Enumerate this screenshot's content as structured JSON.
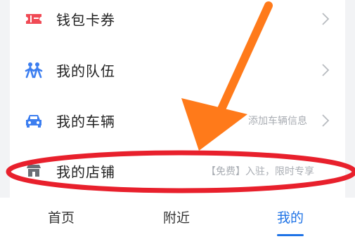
{
  "menu": {
    "items": [
      {
        "label": "钱包卡券",
        "icon": "ticket-icon",
        "hint": ""
      },
      {
        "label": "我的队伍",
        "icon": "team-icon",
        "hint": ""
      },
      {
        "label": "我的车辆",
        "icon": "car-icon",
        "hint": "添加车辆信息"
      },
      {
        "label": "我的店铺",
        "icon": "store-icon",
        "hint": "【免费】入驻，限时专享"
      }
    ]
  },
  "tabbar": {
    "tabs": [
      {
        "label": "首页",
        "active": false
      },
      {
        "label": "附近",
        "active": false
      },
      {
        "label": "我的",
        "active": true
      }
    ]
  },
  "colors": {
    "accent": "#1f73e6",
    "ticket_icon": "#f04a55",
    "team_icon": "#3c7ef0",
    "car_icon": "#3c7ef0",
    "annotation": "#e8202c",
    "arrow": "#ff7a1a"
  }
}
